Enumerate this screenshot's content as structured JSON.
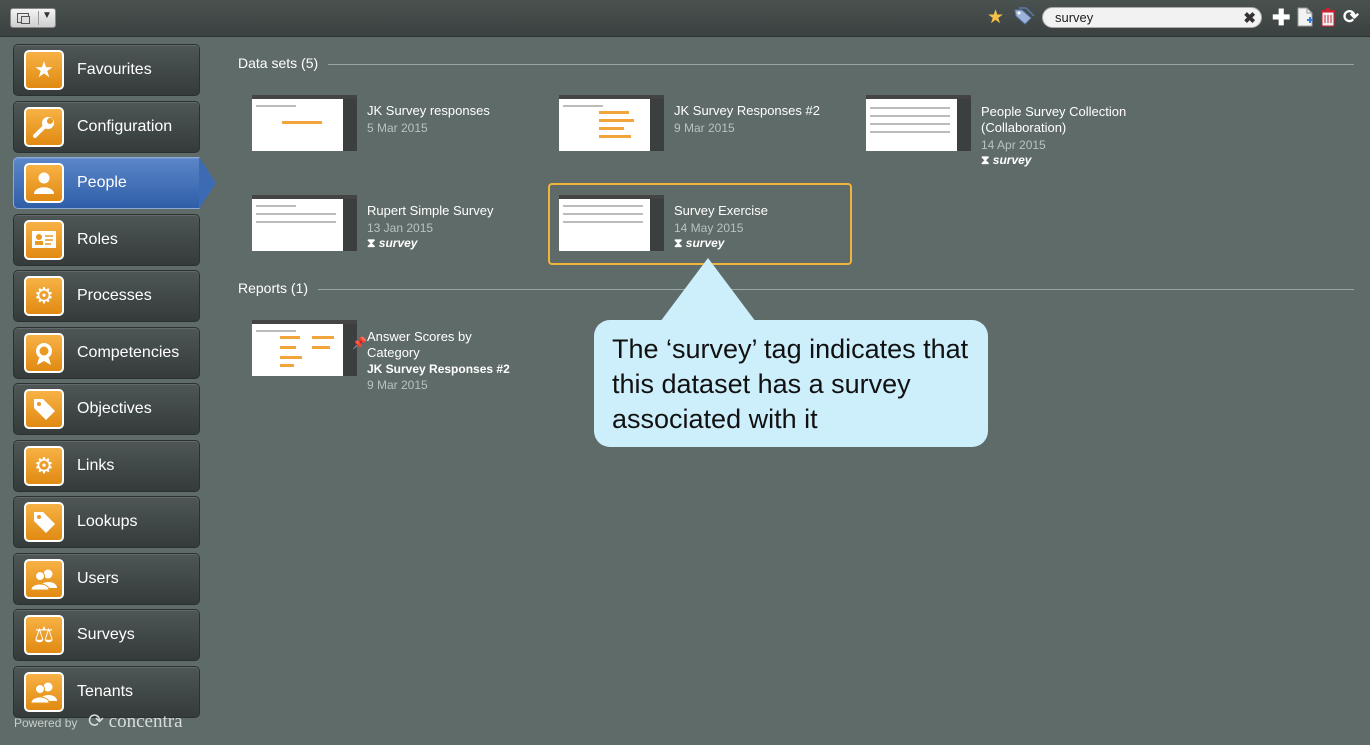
{
  "toolbar": {
    "search_value": "survey",
    "icons": [
      "view-toggle",
      "star-icon",
      "tags-icon",
      "clear-icon",
      "add-icon",
      "new-document-icon",
      "trash-icon",
      "refresh-icon"
    ]
  },
  "sidebar": {
    "items": [
      {
        "label": "Favourites",
        "icon": "star-icon"
      },
      {
        "label": "Configuration",
        "icon": "wrench-icon"
      },
      {
        "label": "People",
        "icon": "person-icon"
      },
      {
        "label": "Roles",
        "icon": "id-card-icon"
      },
      {
        "label": "Processes",
        "icon": "gears-icon"
      },
      {
        "label": "Competencies",
        "icon": "award-icon"
      },
      {
        "label": "Objectives",
        "icon": "tag-icon"
      },
      {
        "label": "Links",
        "icon": "gears-icon"
      },
      {
        "label": "Lookups",
        "icon": "tag-icon"
      },
      {
        "label": "Users",
        "icon": "users-icon"
      },
      {
        "label": "Surveys",
        "icon": "scales-icon"
      },
      {
        "label": "Tenants",
        "icon": "users-icon"
      }
    ],
    "active": "People",
    "powered_by": "Powered by",
    "brand": "concentra"
  },
  "datasets": {
    "title": "Data sets (5)",
    "items": [
      {
        "title": "JK Survey responses",
        "date": "5 Mar 2015",
        "tag": ""
      },
      {
        "title": "JK Survey Responses #2",
        "date": "9 Mar 2015",
        "tag": ""
      },
      {
        "title": "People Survey Collection (Collaboration)",
        "date": "14 Apr 2015",
        "tag": "survey"
      },
      {
        "title": "Rupert Simple Survey",
        "date": "13 Jan 2015",
        "tag": "survey"
      },
      {
        "title": "Survey Exercise",
        "date": "14 May 2015",
        "tag": "survey"
      }
    ]
  },
  "reports": {
    "title": "Reports (1)",
    "items": [
      {
        "title": "Answer Scores by Category",
        "subtitle": "JK Survey Responses #2",
        "date": "9 Mar 2015"
      }
    ]
  },
  "callout": {
    "text": "The ‘survey’ tag indicates that this dataset has a survey associated with it"
  },
  "colors": {
    "background": "#5f6b68",
    "accent_orange": "#f0b43a",
    "active_blue": "#3d6bb3",
    "callout_bg": "#cdeefb"
  }
}
